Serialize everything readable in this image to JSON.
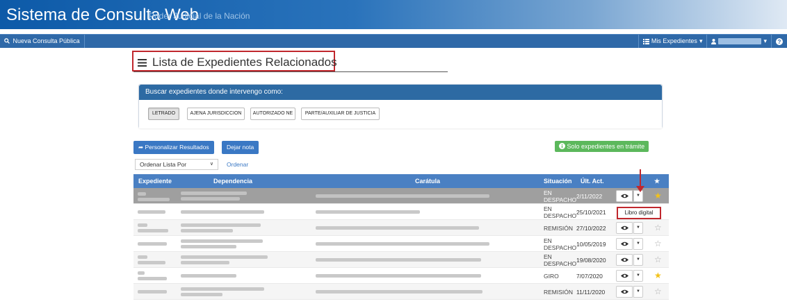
{
  "brand": {
    "title": "Sistema de Consulta Web",
    "subtitle": "Poder Judicial de la Nación"
  },
  "navbar": {
    "new_query": "Nueva Consulta Pública",
    "my_files": "Mis Expedientes",
    "caret": "▾",
    "help": "?"
  },
  "page": {
    "title": "Lista de Expedientes Relacionados"
  },
  "search_panel": {
    "heading": "Buscar expedientes donde intervengo como:",
    "chips": [
      "LETRADO",
      "AJENA JURISDICCION",
      "AUTORIZADO NE",
      "PARTE/AUXILIAR DE JUSTICIA"
    ],
    "active": "LETRADO"
  },
  "actions": {
    "customize": "Personalizar Resultados",
    "note": "Dejar nota",
    "only_active": "Solo expedientes en trámite"
  },
  "sort": {
    "label": "Ordenar Lista Por",
    "chevron": "∨",
    "link": "Ordenar"
  },
  "table": {
    "headers": {
      "expediente": "Expediente",
      "dependencia": "Dependencia",
      "caratula": "Carátula",
      "situacion": "Situación",
      "ult_act": "Últ. Act.",
      "star": "★"
    },
    "rows": [
      {
        "situacion": [
          "EN",
          "DESPACHO"
        ],
        "fecha": "2/11/2022",
        "favorito": true,
        "selected": true
      },
      {
        "situacion": [
          "EN",
          "DESPACHO"
        ],
        "fecha": "25/10/2021",
        "favorito": false,
        "selected": false,
        "menu_open": true
      },
      {
        "situacion": [
          "REMISIÓN"
        ],
        "fecha": "27/10/2022",
        "favorito": false,
        "selected": false
      },
      {
        "situacion": [
          "EN",
          "DESPACHO"
        ],
        "fecha": "10/05/2019",
        "favorito": false,
        "selected": false
      },
      {
        "situacion": [
          "EN",
          "DESPACHO"
        ],
        "fecha": "19/08/2020",
        "favorito": false,
        "selected": false
      },
      {
        "situacion": [
          "GIRO"
        ],
        "fecha": "7/07/2020",
        "favorito": true,
        "selected": false
      },
      {
        "situacion": [
          "REMISIÓN"
        ],
        "fecha": "11/11/2020",
        "favorito": false,
        "selected": false
      }
    ]
  },
  "popover": {
    "label": "Libro digital"
  },
  "colors": {
    "primary": "#3a78c4",
    "header": "#4a80c3",
    "success": "#5cb85c",
    "annotation": "#c0272d",
    "star": "#f3c218"
  }
}
